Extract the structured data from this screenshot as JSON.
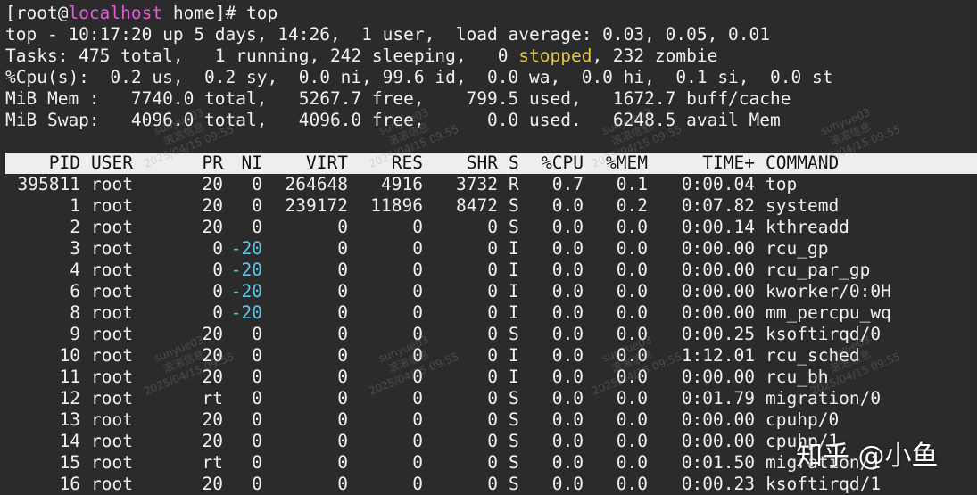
{
  "prompt": {
    "open": "[root@",
    "host": "localhost",
    "close": " home]# top"
  },
  "summary": {
    "line1": "top - 10:17:20 up 5 days, 14:26,  1 user,  load average: 0.03, 0.05, 0.01",
    "tasks_a": "Tasks: 475 total,   1 running, 242 sleeping,   0 ",
    "tasks_stopped": "stopped",
    "tasks_b": ", 232 zombie",
    "cpu": "%Cpu(s):  0.2 us,  0.2 sy,  0.0 ni, 99.6 id,  0.0 wa,  0.0 hi,  0.1 si,  0.0 st",
    "mem": "MiB Mem :   7740.0 total,   5267.7 free,    799.5 used,   1672.7 buff/cache",
    "swap": "MiB Swap:   4096.0 total,   4096.0 free,      0.0 used.   6248.5 avail Mem"
  },
  "columns": {
    "pid": "PID",
    "user": "USER",
    "pr": "PR",
    "ni": "NI",
    "virt": "VIRT",
    "res": "RES",
    "shr": "SHR",
    "s": "S",
    "cpu": "%CPU",
    "mem": "%MEM",
    "time": "TIME+",
    "command": "COMMAND"
  },
  "processes": [
    {
      "pid": "395811",
      "user": "root",
      "pr": "20",
      "ni": "0",
      "virt": "264648",
      "res": "4916",
      "shr": "3732",
      "s": "R",
      "cpu": "0.7",
      "mem": "0.1",
      "time": "0:00.04",
      "command": "top"
    },
    {
      "pid": "1",
      "user": "root",
      "pr": "20",
      "ni": "0",
      "virt": "239172",
      "res": "11896",
      "shr": "8472",
      "s": "S",
      "cpu": "0.0",
      "mem": "0.2",
      "time": "0:07.82",
      "command": "systemd"
    },
    {
      "pid": "2",
      "user": "root",
      "pr": "20",
      "ni": "0",
      "virt": "0",
      "res": "0",
      "shr": "0",
      "s": "S",
      "cpu": "0.0",
      "mem": "0.0",
      "time": "0:00.14",
      "command": "kthreadd"
    },
    {
      "pid": "3",
      "user": "root",
      "pr": "0",
      "ni": "-20",
      "virt": "0",
      "res": "0",
      "shr": "0",
      "s": "I",
      "cpu": "0.0",
      "mem": "0.0",
      "time": "0:00.00",
      "command": "rcu_gp"
    },
    {
      "pid": "4",
      "user": "root",
      "pr": "0",
      "ni": "-20",
      "virt": "0",
      "res": "0",
      "shr": "0",
      "s": "I",
      "cpu": "0.0",
      "mem": "0.0",
      "time": "0:00.00",
      "command": "rcu_par_gp"
    },
    {
      "pid": "6",
      "user": "root",
      "pr": "0",
      "ni": "-20",
      "virt": "0",
      "res": "0",
      "shr": "0",
      "s": "I",
      "cpu": "0.0",
      "mem": "0.0",
      "time": "0:00.00",
      "command": "kworker/0:0H"
    },
    {
      "pid": "8",
      "user": "root",
      "pr": "0",
      "ni": "-20",
      "virt": "0",
      "res": "0",
      "shr": "0",
      "s": "I",
      "cpu": "0.0",
      "mem": "0.0",
      "time": "0:00.00",
      "command": "mm_percpu_wq"
    },
    {
      "pid": "9",
      "user": "root",
      "pr": "20",
      "ni": "0",
      "virt": "0",
      "res": "0",
      "shr": "0",
      "s": "S",
      "cpu": "0.0",
      "mem": "0.0",
      "time": "0:00.25",
      "command": "ksoftirqd/0"
    },
    {
      "pid": "10",
      "user": "root",
      "pr": "20",
      "ni": "0",
      "virt": "0",
      "res": "0",
      "shr": "0",
      "s": "I",
      "cpu": "0.0",
      "mem": "0.0",
      "time": "1:12.01",
      "command": "rcu_sched"
    },
    {
      "pid": "11",
      "user": "root",
      "pr": "20",
      "ni": "0",
      "virt": "0",
      "res": "0",
      "shr": "0",
      "s": "I",
      "cpu": "0.0",
      "mem": "0.0",
      "time": "0:00.00",
      "command": "rcu_bh"
    },
    {
      "pid": "12",
      "user": "root",
      "pr": "rt",
      "ni": "0",
      "virt": "0",
      "res": "0",
      "shr": "0",
      "s": "S",
      "cpu": "0.0",
      "mem": "0.0",
      "time": "0:01.79",
      "command": "migration/0"
    },
    {
      "pid": "13",
      "user": "root",
      "pr": "20",
      "ni": "0",
      "virt": "0",
      "res": "0",
      "shr": "0",
      "s": "S",
      "cpu": "0.0",
      "mem": "0.0",
      "time": "0:00.00",
      "command": "cpuhp/0"
    },
    {
      "pid": "14",
      "user": "root",
      "pr": "20",
      "ni": "0",
      "virt": "0",
      "res": "0",
      "shr": "0",
      "s": "S",
      "cpu": "0.0",
      "mem": "0.0",
      "time": "0:00.00",
      "command": "cpuhp/1"
    },
    {
      "pid": "15",
      "user": "root",
      "pr": "rt",
      "ni": "0",
      "virt": "0",
      "res": "0",
      "shr": "0",
      "s": "S",
      "cpu": "0.0",
      "mem": "0.0",
      "time": "0:01.50",
      "command": "migration/1"
    },
    {
      "pid": "16",
      "user": "root",
      "pr": "20",
      "ni": "0",
      "virt": "0",
      "res": "0",
      "shr": "0",
      "s": "S",
      "cpu": "0.0",
      "mem": "0.0",
      "time": "0:00.23",
      "command": "ksoftirqd/1"
    }
  ],
  "watermark": {
    "user": "sunyue03",
    "org": "滚滚信息",
    "date": "2025/04/15 09:55"
  },
  "brand": "知乎 @小鱼",
  "colors": {
    "background": "#2b2b2b",
    "foreground": "#f0f0f0",
    "host": "#e25ad8",
    "stopped": "#e2c73a",
    "negative_nice": "#5ec6e8",
    "header_bar": "#eeeeee"
  }
}
